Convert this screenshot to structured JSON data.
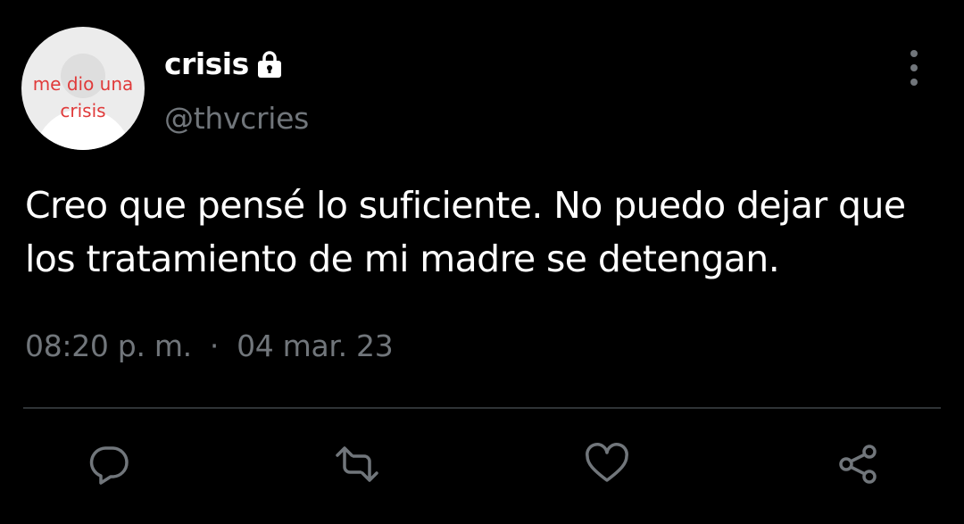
{
  "author": {
    "avatar_caption_line1": "me dio una",
    "avatar_caption_line2": "crisis",
    "display_name": "crisis",
    "handle": "@thvcries",
    "protected_icon": "lock-icon"
  },
  "tweet": {
    "text": "Creo que pensé lo suficiente. No puedo dejar que los tratamiento de mi madre se detengan.",
    "time": "08:20 p. m.",
    "separator": "·",
    "date": "04 mar. 23"
  },
  "actions": {
    "reply_icon": "reply-icon",
    "retweet_icon": "retweet-icon",
    "like_icon": "heart-icon",
    "share_icon": "share-icon"
  },
  "colors": {
    "background": "#000000",
    "primary_text": "#ffffff",
    "secondary_text": "#71767b",
    "avatar_caption": "#e03a3a",
    "divider": "#2f3336"
  }
}
